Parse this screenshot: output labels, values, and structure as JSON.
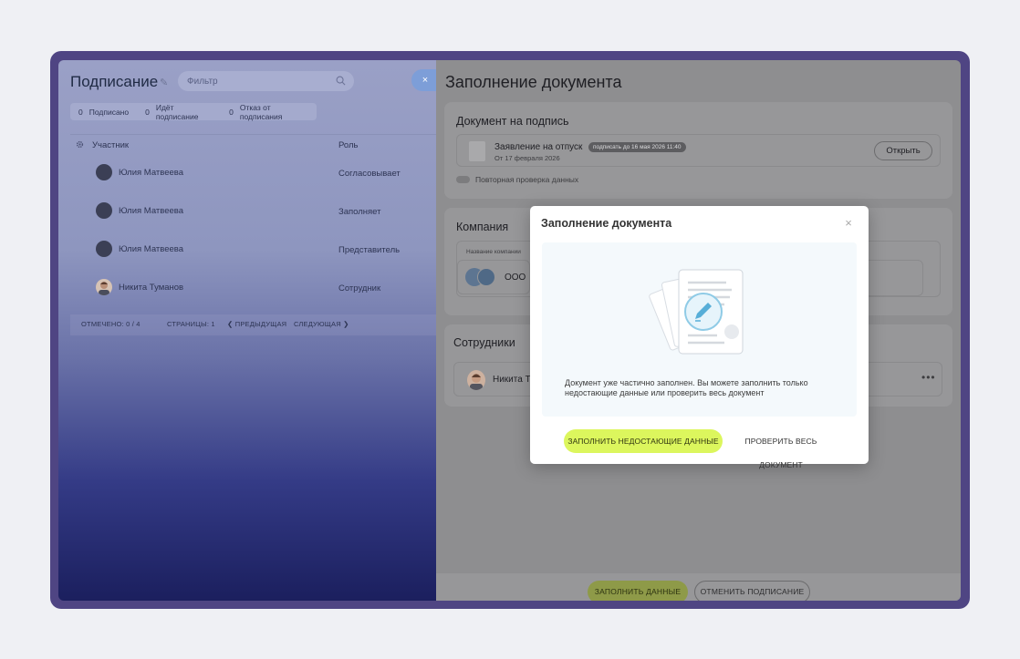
{
  "left": {
    "title": "Подписание",
    "filter_placeholder": "Фильтр",
    "close_label": "×",
    "chips": [
      {
        "count": "0",
        "label": "Подписано"
      },
      {
        "count": "0",
        "label": "Идёт подписание"
      },
      {
        "count": "0",
        "label": "Отказ от подписания"
      }
    ],
    "columns": {
      "participant": "Участник",
      "role": "Роль"
    },
    "rows": [
      {
        "name": "Юлия Матвеева",
        "role": "Согласовывает"
      },
      {
        "name": "Юлия Матвеева",
        "role": "Заполняет"
      },
      {
        "name": "Юлия Матвеева",
        "role": "Представитель"
      },
      {
        "name": "Никита Туманов",
        "role": "Сотрудник"
      }
    ],
    "pager": {
      "marked": "ОТМЕЧЕНО: 0 / 4",
      "pages": "СТРАНИЦЫ: 1",
      "prev": "❮ ПРЕДЫДУЩАЯ",
      "next": "СЛЕДУЮЩАЯ ❯"
    }
  },
  "right": {
    "title": "Заполнение документа",
    "doc_section": {
      "title": "Документ на подпись",
      "doc_name": "Заявление на отпуск",
      "badge": "подписать до 16 мая 2026 11:40",
      "date": "От 17 февраля 2026",
      "open_label": "Открыть",
      "recheck_label": "Повторная проверка данных"
    },
    "company_section": {
      "title": "Компания",
      "field_label": "Название компании",
      "company_name": "ООО"
    },
    "employees_section": {
      "title": "Сотрудники",
      "employee_name": "Никита Т",
      "more": "•••"
    },
    "bottom": {
      "fill_label": "ЗАПОЛНИТЬ ДАННЫЕ",
      "cancel_label": "ОТМЕНИТЬ ПОДПИСАНИЕ"
    }
  },
  "modal": {
    "title": "Заполнение документа",
    "close": "×",
    "text": "Документ уже частично заполнен. Вы можете заполнить только недостающие данные или проверить весь документ",
    "primary_label": "ЗАПОЛНИТЬ НЕДОСТАЮЩИЕ ДАННЫЕ",
    "secondary_label": "ПРОВЕРИТЬ ВЕСЬ ДОКУМЕНТ"
  },
  "colors": {
    "frame": "#4f4583",
    "accent_green": "#dcf65d",
    "close_blue": "#7d9ed8"
  }
}
